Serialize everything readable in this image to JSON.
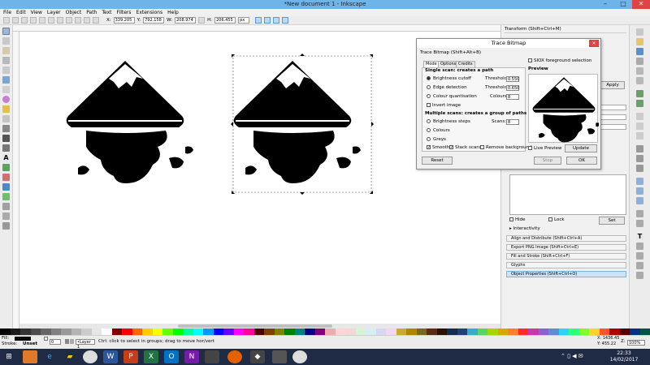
{
  "window": {
    "title": "*New document 1 - Inkscape"
  },
  "menu": [
    "File",
    "Edit",
    "View",
    "Layer",
    "Object",
    "Path",
    "Text",
    "Filters",
    "Extensions",
    "Help"
  ],
  "toolctrl": {
    "x_label": "X:",
    "x_value": "339.205",
    "y_label": "Y:",
    "y_value": "792.158",
    "w_label": "W:",
    "w_value": "208.974",
    "h_label": "H:",
    "h_value": "206.455",
    "unit": "px"
  },
  "trace_dialog": {
    "window_title": "Trace Bitmap",
    "header": "Trace Bitmap (Shift+Alt+B)",
    "tabs": [
      "Mode",
      "Options",
      "Credits"
    ],
    "single_scan_header": "Single scan: creates a path",
    "brightness_cutoff": "Brightness cutoff",
    "edge_detection": "Edge detection",
    "colour_quantisation": "Colour quantisation",
    "invert_image": "Invert image",
    "threshold_label": "Threshold:",
    "threshold1": "0.550",
    "threshold2": "0.650",
    "colours_label": "Colours:",
    "colours_value": "8",
    "multiple_header": "Multiple scans: creates a group of paths",
    "brightness_steps": "Brightness steps",
    "scans_label": "Scans:",
    "scans_value": "8",
    "colours": "Colours",
    "greys": "Greys",
    "smooth": "Smooth",
    "stack_scans": "Stack scans",
    "remove_background": "Remove background",
    "siox": "SIOX foreground selection",
    "preview_label": "Preview",
    "live_preview": "Live Preview",
    "update": "Update",
    "reset": "Reset",
    "stop": "Stop",
    "ok": "OK"
  },
  "dock": {
    "transform_title": "Transform (Shift+Ctrl+M)",
    "apply": "Apply",
    "hide_label": "Hide",
    "lock_label": "Lock",
    "set": "Set",
    "interactivity": "Interactivity",
    "panels": [
      "Align and Distribute (Shift+Ctrl+A)",
      "Export PNG Image (Shift+Ctrl+E)",
      "Fill and Stroke (Shift+Ctrl+F)",
      "Glyphs",
      "Object Properties (Shift+Ctrl+O)"
    ]
  },
  "status": {
    "fill_label": "Fill:",
    "stroke_label": "Stroke:",
    "stroke_value": "Unset",
    "opacity": "0",
    "layer": "•Layer 1",
    "message": "Ctrl: click to select in groups; drag to move hor/vert",
    "x": "X: 1436.45",
    "y": "Y: 455.22",
    "z": "Z:",
    "zoom": "100%"
  },
  "taskbar": {
    "time": "22:33",
    "date": "14/02/2017"
  },
  "palette": [
    "#000000",
    "#1a1a1a",
    "#333333",
    "#4d4d4d",
    "#666666",
    "#808080",
    "#999999",
    "#b3b3b3",
    "#cccccc",
    "#e6e6e6",
    "#ffffff",
    "#800000",
    "#ff0000",
    "#ff6600",
    "#ffcc00",
    "#ffff00",
    "#66ff00",
    "#00ff00",
    "#00ff99",
    "#00ffff",
    "#0099ff",
    "#0000ff",
    "#6600ff",
    "#ff00ff",
    "#ff0099",
    "#4d0000",
    "#804000",
    "#808000",
    "#008000",
    "#008080",
    "#000080",
    "#800080",
    "#e9afaf",
    "#ffd5d5",
    "#f4d7d7",
    "#d7f4d7",
    "#d7eef4",
    "#d7d7f4",
    "#f4d7f4",
    "#c8ab37",
    "#aa8800",
    "#786721",
    "#5a2c16",
    "#2b1100",
    "#162d50",
    "#213f78",
    "#37abc8",
    "#5fd35f",
    "#aad400",
    "#d4aa00",
    "#ff7f2a",
    "#ff2a2a",
    "#c837ab",
    "#8d5fd3",
    "#5f8dd3",
    "#2ad4ff",
    "#2aff80",
    "#80ff2a",
    "#ffd42a",
    "#ff552a",
    "#aa0000",
    "#550000",
    "#003380",
    "#005544"
  ]
}
